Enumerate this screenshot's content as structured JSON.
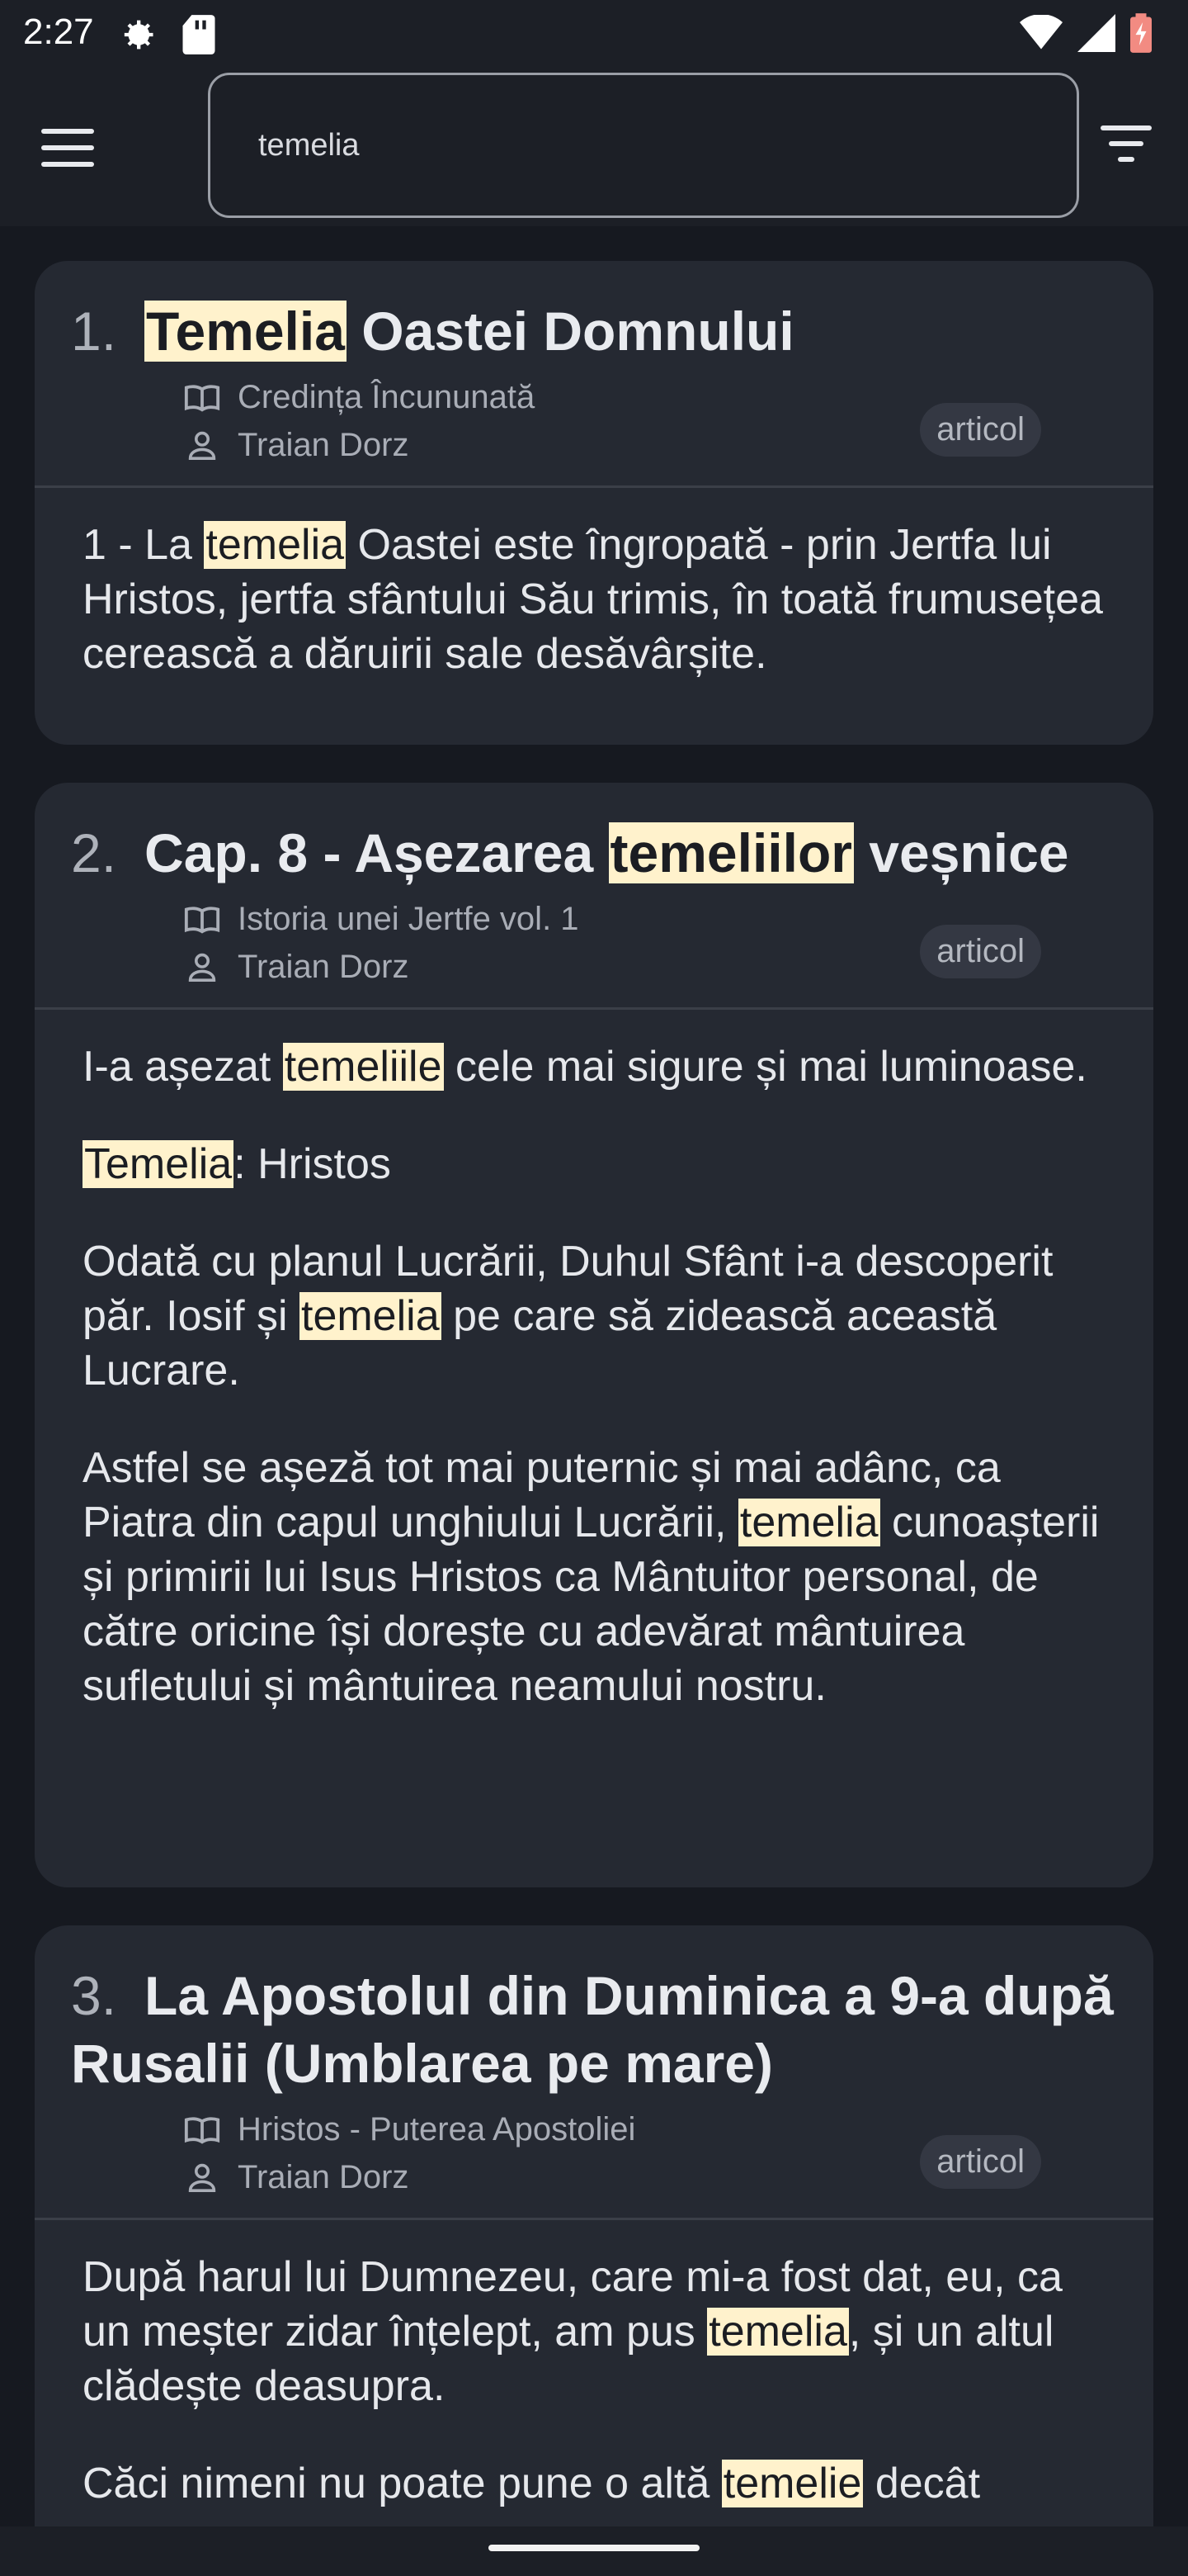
{
  "status": {
    "time": "2:27"
  },
  "search": {
    "value": "temelia"
  },
  "results": [
    {
      "number": "1.",
      "title_parts": [
        {
          "text": "Temelia",
          "hl": true
        },
        {
          "text": " Oastei Domnului",
          "hl": false
        }
      ],
      "book": "Credința Încununată",
      "author": "Traian Dorz",
      "type": "articol",
      "paragraphs": [
        [
          {
            "text": "1 - La ",
            "hl": false
          },
          {
            "text": "temelia",
            "hl": true
          },
          {
            "text": " Oastei este îngropată - prin Jertfa lui Hristos, jertfa sfântului Său trimis, în toată frumusețea cerească a dăruirii sale desăvârșite.",
            "hl": false
          }
        ]
      ]
    },
    {
      "number": "2.",
      "title_parts": [
        {
          "text": "Cap. 8 - Așezarea ",
          "hl": false
        },
        {
          "text": "temeliilor",
          "hl": true
        },
        {
          "text": " veșnice",
          "hl": false
        }
      ],
      "book": "Istoria unei Jertfe vol. 1",
      "author": "Traian Dorz",
      "type": "articol",
      "paragraphs": [
        [
          {
            "text": "I-a așezat ",
            "hl": false
          },
          {
            "text": "temeliile",
            "hl": true
          },
          {
            "text": " cele mai sigure și mai luminoase.",
            "hl": false
          }
        ],
        [
          {
            "text": "Temelia",
            "hl": true
          },
          {
            "text": ": Hristos",
            "hl": false
          }
        ],
        [
          {
            "text": "Odată cu planul Lucrării, Duhul Sfânt i-a descoperit păr. Iosif și ",
            "hl": false
          },
          {
            "text": "temelia",
            "hl": true
          },
          {
            "text": " pe care să zidească această Lucrare.",
            "hl": false
          }
        ],
        [
          {
            "text": "Astfel se așeză tot mai puternic și mai adânc, ca Piatra din capul unghiului Lucrării, ",
            "hl": false
          },
          {
            "text": "temelia",
            "hl": true
          },
          {
            "text": " cunoașterii și primirii lui Isus Hristos ca Mântuitor personal, de către oricine își dorește cu adevărat mântuirea sufletului și mântuirea neamului nostru.",
            "hl": false
          }
        ]
      ]
    },
    {
      "number": "3.",
      "title_parts": [
        {
          "text": "La Apostolul din Duminica a 9-a după Rusalii (Umblarea pe mare)",
          "hl": false
        }
      ],
      "book": "Hristos - Puterea Apostoliei",
      "author": "Traian Dorz",
      "type": "articol",
      "paragraphs": [
        [
          {
            "text": "După harul lui Dumnezeu, care mi-a fost dat, eu, ca un meșter zidar înțelept, am pus ",
            "hl": false
          },
          {
            "text": "temelia",
            "hl": true
          },
          {
            "text": ", și un altul clădește deasupra.",
            "hl": false
          }
        ],
        [
          {
            "text": "Căci nimeni nu poate pune o altă ",
            "hl": false
          },
          {
            "text": "temelie",
            "hl": true
          },
          {
            "text": " decât",
            "hl": false
          }
        ]
      ]
    }
  ]
}
